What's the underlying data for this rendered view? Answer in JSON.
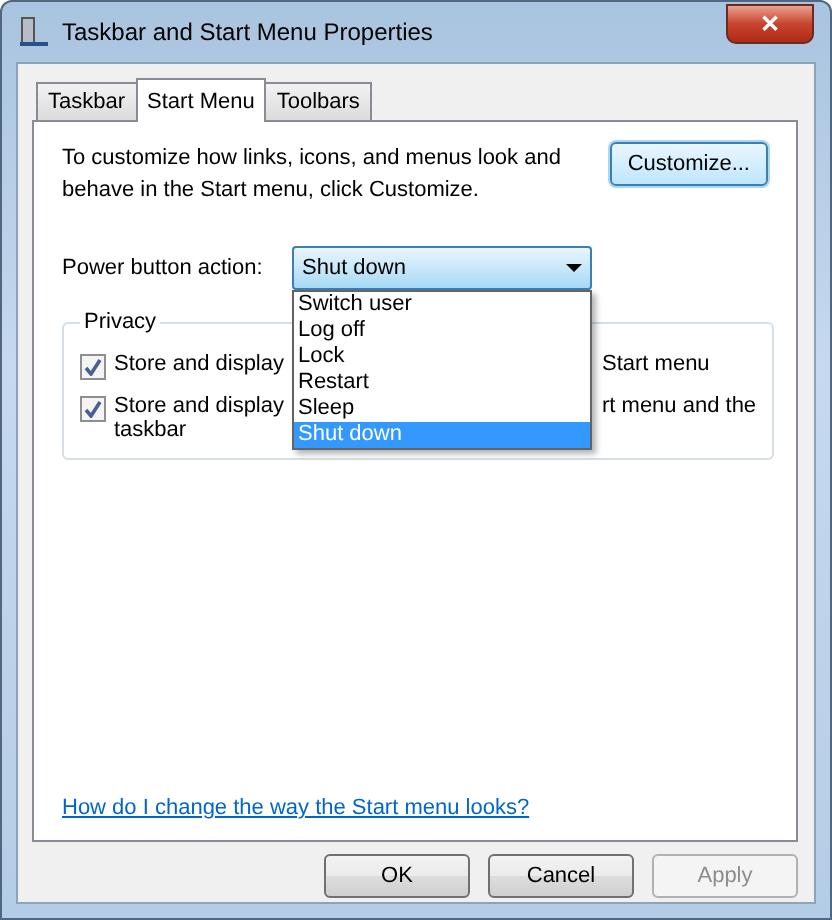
{
  "window": {
    "title": "Taskbar and Start Menu Properties",
    "close": "✕"
  },
  "tabs": [
    {
      "label": "Taskbar",
      "selected": false
    },
    {
      "label": "Start Menu",
      "selected": true
    },
    {
      "label": "Toolbars",
      "selected": false
    }
  ],
  "intro": "To customize how links, icons, and menus look and behave in the Start menu, click Customize.",
  "customize_button": "Customize...",
  "power": {
    "label": "Power button action:",
    "value": "Shut down",
    "expanded": true,
    "options": [
      {
        "label": "Switch user",
        "selected": false
      },
      {
        "label": "Log off",
        "selected": false
      },
      {
        "label": "Lock",
        "selected": false
      },
      {
        "label": "Restart",
        "selected": false
      },
      {
        "label": "Sleep",
        "selected": false
      },
      {
        "label": "Shut down",
        "selected": true
      }
    ]
  },
  "privacy": {
    "title": "Privacy",
    "items": [
      {
        "text_start": "Store and display",
        "text_end": "Start menu",
        "checked": true
      },
      {
        "text_start": "Store and display",
        "text_end": "rt menu and the",
        "text_more": "taskbar",
        "checked": true
      }
    ]
  },
  "help_link": "How do I change the way the Start menu looks?",
  "buttons": [
    {
      "label": "OK",
      "disabled": false
    },
    {
      "label": "Cancel",
      "disabled": false
    },
    {
      "label": "Apply",
      "disabled": true
    }
  ]
}
